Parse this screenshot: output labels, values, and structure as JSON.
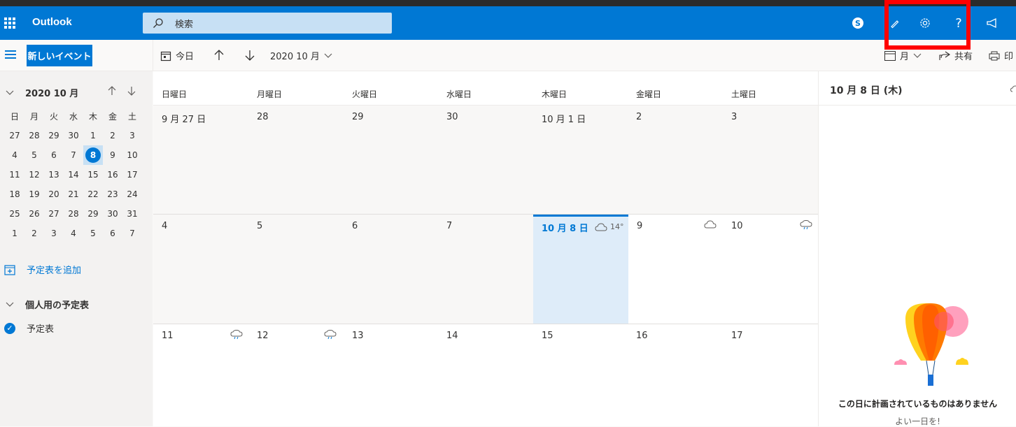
{
  "app": {
    "name": "Outlook"
  },
  "search": {
    "placeholder": "検索"
  },
  "toolbar": {
    "new_event": "新しいイベント",
    "today": "今日",
    "month_label": "2020 10 月",
    "view": "月",
    "share": "共有",
    "print": "印"
  },
  "mini_calendar": {
    "title": "2020 10 月",
    "weekdays": [
      "日",
      "月",
      "火",
      "水",
      "木",
      "金",
      "土"
    ],
    "weeks": [
      [
        "27",
        "28",
        "29",
        "30",
        "1",
        "2",
        "3"
      ],
      [
        "4",
        "5",
        "6",
        "7",
        "8",
        "9",
        "10"
      ],
      [
        "11",
        "12",
        "13",
        "14",
        "15",
        "16",
        "17"
      ],
      [
        "18",
        "19",
        "20",
        "21",
        "22",
        "23",
        "24"
      ],
      [
        "25",
        "26",
        "27",
        "28",
        "29",
        "30",
        "31"
      ],
      [
        "1",
        "2",
        "3",
        "4",
        "5",
        "6",
        "7"
      ]
    ],
    "selected": "8"
  },
  "sidebar": {
    "add_calendar": "予定表を追加",
    "group": "個人用の予定表",
    "calendar": "予定表"
  },
  "month_grid": {
    "weekdays": [
      "日曜日",
      "月曜日",
      "火曜日",
      "水曜日",
      "木曜日",
      "金曜日",
      "土曜日"
    ],
    "weeks": [
      {
        "days": [
          "9 月 27 日",
          "28",
          "29",
          "30",
          "10 月 1 日",
          "2",
          "3"
        ]
      },
      {
        "days": [
          "4",
          "5",
          "6",
          "7",
          "10 月 8 日",
          "9",
          "10"
        ]
      },
      {
        "days": [
          "11",
          "12",
          "13",
          "14",
          "15",
          "16",
          "17"
        ]
      }
    ],
    "today_temp": "14°"
  },
  "agenda": {
    "date": "10 月 8 日 (木)",
    "empty_title": "この日に計画されているものはありません",
    "empty_sub": "よい一日を!"
  },
  "colors": {
    "brand": "#0078d4",
    "highlight": "#ff0000",
    "today_bg": "#deecf9"
  }
}
